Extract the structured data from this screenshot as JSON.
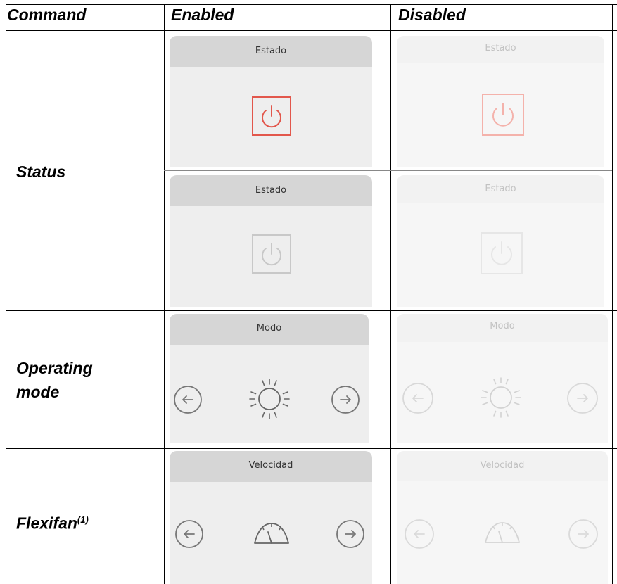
{
  "table": {
    "headers": {
      "command": "Command",
      "enabled": "Enabled",
      "disabled": "Disabled"
    },
    "rows": [
      {
        "label": "Status",
        "widgets": [
          {
            "title": "Estado",
            "icon": "power-icon",
            "state": "on"
          },
          {
            "title": "Estado",
            "icon": "power-icon",
            "state": "off"
          }
        ]
      },
      {
        "label_line1": "Operating",
        "label_line2": "mode",
        "widget": {
          "title": "Modo",
          "left_icon": "arrow-left-icon",
          "center_icon": "sun-icon",
          "right_icon": "arrow-right-icon"
        }
      },
      {
        "label": "Flexifan",
        "label_sup": "(1)",
        "widget": {
          "title": "Velocidad",
          "left_icon": "arrow-left-icon",
          "center_icon": "speed-gauge-icon",
          "right_icon": "arrow-right-icon"
        }
      }
    ]
  },
  "colors": {
    "power_on": "#e2574c",
    "icon_enabled": "#666666",
    "icon_disabled": "#d4d4d4"
  }
}
